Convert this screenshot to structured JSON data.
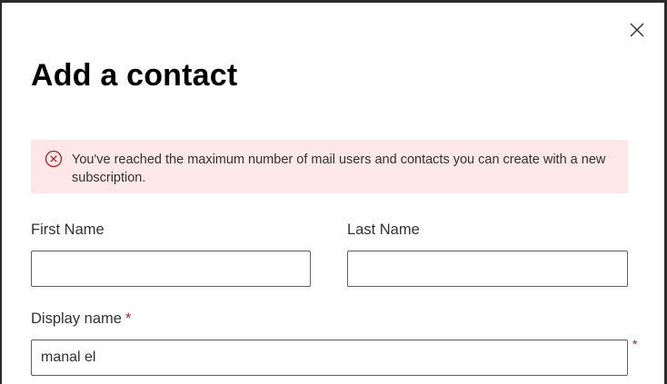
{
  "dialog": {
    "title": "Add a contact",
    "close_icon": "close-icon"
  },
  "error": {
    "icon": "error-circle-icon",
    "message": "You've reached the maximum number of mail users and contacts you can create with a new subscription."
  },
  "form": {
    "first_name": {
      "label": "First Name",
      "value": ""
    },
    "last_name": {
      "label": "Last Name",
      "value": ""
    },
    "display_name": {
      "label": "Display name",
      "required_marker": "*",
      "value": "manal el"
    }
  },
  "colors": {
    "error_background": "#fde7e9",
    "error_icon": "#a4262c",
    "required": "#a4262c",
    "text": "#323130"
  }
}
